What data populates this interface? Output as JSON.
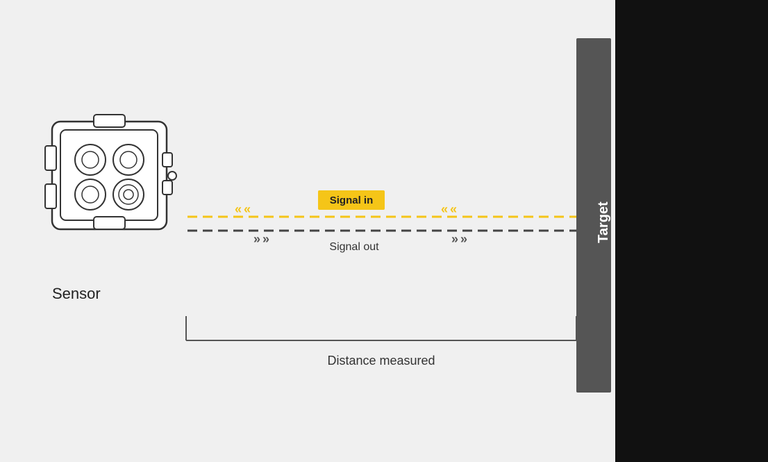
{
  "diagram": {
    "background_color": "#f0f0f0",
    "sensor_label": "Sensor",
    "target_label": "Target",
    "signal_in_label": "Signal in",
    "signal_out_label": "Signal out",
    "distance_label": "Distance measured",
    "yellow_color": "#f5c518",
    "dark_color": "#333333",
    "target_bar_color": "#555555",
    "right_panel_color": "#111111"
  }
}
